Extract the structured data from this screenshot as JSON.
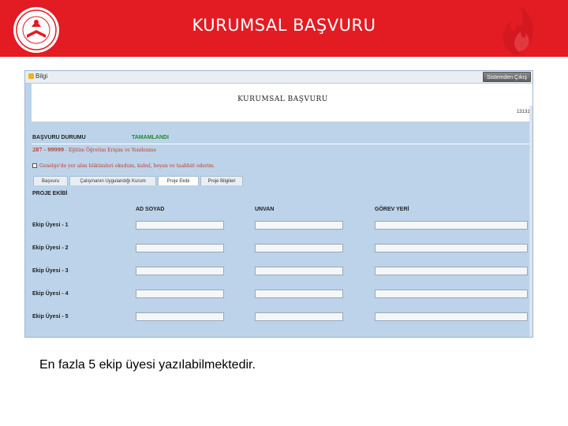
{
  "slide": {
    "title": "KURUMSAL BAŞVURU",
    "caption": "En fazla 5 ekip üyesi yazılabilmektedir.",
    "colors": {
      "header": "#e31b23",
      "panel": "#bcd3e9",
      "status": "#1f8a2c",
      "notice": "#c0392b"
    }
  },
  "app": {
    "back_label": "Bilgi",
    "exit_label": "Sistemden Çıkış",
    "form_title": "KURUMSAL BAŞVURU",
    "app_id": "131312",
    "status_label": "BAŞVURU DURUMU",
    "status_value": "TAMAMLANDI",
    "circular_code": "287 - 99999",
    "circular_text": " - Eğitim Öğretim Erişim ve Yenilenme",
    "agree_text": "Genelge'de yer alan hükümleri okudum, kabul, beyan ve taahhüt ederim.",
    "tabs": [
      "Başvuru",
      "Çalışmanın Uygulandığı Kurum",
      "Proje Ekibi",
      "Proje Bilgileri"
    ],
    "active_tab": "Proje Ekibi",
    "team_heading": "PROJE EKİBİ",
    "columns": [
      "AD SOYAD",
      "UNVAN",
      "GÖREV YERİ"
    ],
    "rows": [
      "Ekip Üyesi - 1",
      "Ekip Üyesi - 2",
      "Ekip Üyesi - 3",
      "Ekip Üyesi - 4",
      "Ekip Üyesi - 5"
    ]
  },
  "icons": {
    "logo": "meb-logo-icon",
    "flame": "flame-icon",
    "checkbox": "checkbox-icon"
  }
}
